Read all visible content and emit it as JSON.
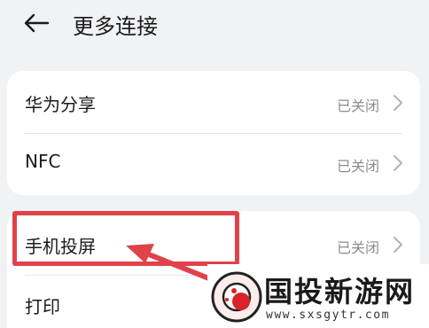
{
  "header": {
    "title": "更多连接",
    "back_icon": "back-arrow-icon"
  },
  "settings": [
    {
      "label": "华为分享",
      "status": "已关闭"
    },
    {
      "label": "NFC",
      "status": "已关闭"
    },
    {
      "label": "手机投屏",
      "status": "已关闭"
    },
    {
      "label": "打印"
    }
  ],
  "annotation": {
    "highlight_color": "#e0424a"
  },
  "watermark": {
    "title": "国投新游网",
    "url": "www.sxsgytr.com"
  }
}
